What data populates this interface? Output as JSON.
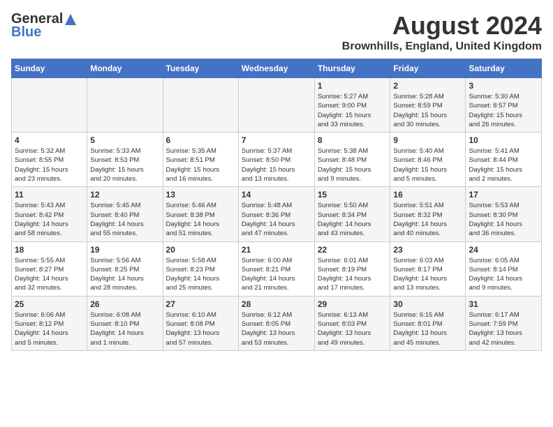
{
  "header": {
    "logo_general": "General",
    "logo_blue": "Blue",
    "month_year": "August 2024",
    "location": "Brownhills, England, United Kingdom"
  },
  "days_of_week": [
    "Sunday",
    "Monday",
    "Tuesday",
    "Wednesday",
    "Thursday",
    "Friday",
    "Saturday"
  ],
  "weeks": [
    [
      {
        "day": "",
        "content": ""
      },
      {
        "day": "",
        "content": ""
      },
      {
        "day": "",
        "content": ""
      },
      {
        "day": "",
        "content": ""
      },
      {
        "day": "1",
        "content": "Sunrise: 5:27 AM\nSunset: 9:00 PM\nDaylight: 15 hours\nand 33 minutes."
      },
      {
        "day": "2",
        "content": "Sunrise: 5:28 AM\nSunset: 8:59 PM\nDaylight: 15 hours\nand 30 minutes."
      },
      {
        "day": "3",
        "content": "Sunrise: 5:30 AM\nSunset: 8:57 PM\nDaylight: 15 hours\nand 26 minutes."
      }
    ],
    [
      {
        "day": "4",
        "content": "Sunrise: 5:32 AM\nSunset: 8:55 PM\nDaylight: 15 hours\nand 23 minutes."
      },
      {
        "day": "5",
        "content": "Sunrise: 5:33 AM\nSunset: 8:53 PM\nDaylight: 15 hours\nand 20 minutes."
      },
      {
        "day": "6",
        "content": "Sunrise: 5:35 AM\nSunset: 8:51 PM\nDaylight: 15 hours\nand 16 minutes."
      },
      {
        "day": "7",
        "content": "Sunrise: 5:37 AM\nSunset: 8:50 PM\nDaylight: 15 hours\nand 13 minutes."
      },
      {
        "day": "8",
        "content": "Sunrise: 5:38 AM\nSunset: 8:48 PM\nDaylight: 15 hours\nand 9 minutes."
      },
      {
        "day": "9",
        "content": "Sunrise: 5:40 AM\nSunset: 8:46 PM\nDaylight: 15 hours\nand 5 minutes."
      },
      {
        "day": "10",
        "content": "Sunrise: 5:41 AM\nSunset: 8:44 PM\nDaylight: 15 hours\nand 2 minutes."
      }
    ],
    [
      {
        "day": "11",
        "content": "Sunrise: 5:43 AM\nSunset: 8:42 PM\nDaylight: 14 hours\nand 58 minutes."
      },
      {
        "day": "12",
        "content": "Sunrise: 5:45 AM\nSunset: 8:40 PM\nDaylight: 14 hours\nand 55 minutes."
      },
      {
        "day": "13",
        "content": "Sunrise: 5:46 AM\nSunset: 8:38 PM\nDaylight: 14 hours\nand 51 minutes."
      },
      {
        "day": "14",
        "content": "Sunrise: 5:48 AM\nSunset: 8:36 PM\nDaylight: 14 hours\nand 47 minutes."
      },
      {
        "day": "15",
        "content": "Sunrise: 5:50 AM\nSunset: 8:34 PM\nDaylight: 14 hours\nand 43 minutes."
      },
      {
        "day": "16",
        "content": "Sunrise: 5:51 AM\nSunset: 8:32 PM\nDaylight: 14 hours\nand 40 minutes."
      },
      {
        "day": "17",
        "content": "Sunrise: 5:53 AM\nSunset: 8:30 PM\nDaylight: 14 hours\nand 36 minutes."
      }
    ],
    [
      {
        "day": "18",
        "content": "Sunrise: 5:55 AM\nSunset: 8:27 PM\nDaylight: 14 hours\nand 32 minutes."
      },
      {
        "day": "19",
        "content": "Sunrise: 5:56 AM\nSunset: 8:25 PM\nDaylight: 14 hours\nand 28 minutes."
      },
      {
        "day": "20",
        "content": "Sunrise: 5:58 AM\nSunset: 8:23 PM\nDaylight: 14 hours\nand 25 minutes."
      },
      {
        "day": "21",
        "content": "Sunrise: 6:00 AM\nSunset: 8:21 PM\nDaylight: 14 hours\nand 21 minutes."
      },
      {
        "day": "22",
        "content": "Sunrise: 6:01 AM\nSunset: 8:19 PM\nDaylight: 14 hours\nand 17 minutes."
      },
      {
        "day": "23",
        "content": "Sunrise: 6:03 AM\nSunset: 8:17 PM\nDaylight: 14 hours\nand 13 minutes."
      },
      {
        "day": "24",
        "content": "Sunrise: 6:05 AM\nSunset: 8:14 PM\nDaylight: 14 hours\nand 9 minutes."
      }
    ],
    [
      {
        "day": "25",
        "content": "Sunrise: 6:06 AM\nSunset: 8:12 PM\nDaylight: 14 hours\nand 5 minutes."
      },
      {
        "day": "26",
        "content": "Sunrise: 6:08 AM\nSunset: 8:10 PM\nDaylight: 14 hours\nand 1 minute."
      },
      {
        "day": "27",
        "content": "Sunrise: 6:10 AM\nSunset: 8:08 PM\nDaylight: 13 hours\nand 57 minutes."
      },
      {
        "day": "28",
        "content": "Sunrise: 6:12 AM\nSunset: 8:05 PM\nDaylight: 13 hours\nand 53 minutes."
      },
      {
        "day": "29",
        "content": "Sunrise: 6:13 AM\nSunset: 8:03 PM\nDaylight: 13 hours\nand 49 minutes."
      },
      {
        "day": "30",
        "content": "Sunrise: 6:15 AM\nSunset: 8:01 PM\nDaylight: 13 hours\nand 45 minutes."
      },
      {
        "day": "31",
        "content": "Sunrise: 6:17 AM\nSunset: 7:59 PM\nDaylight: 13 hours\nand 42 minutes."
      }
    ]
  ]
}
